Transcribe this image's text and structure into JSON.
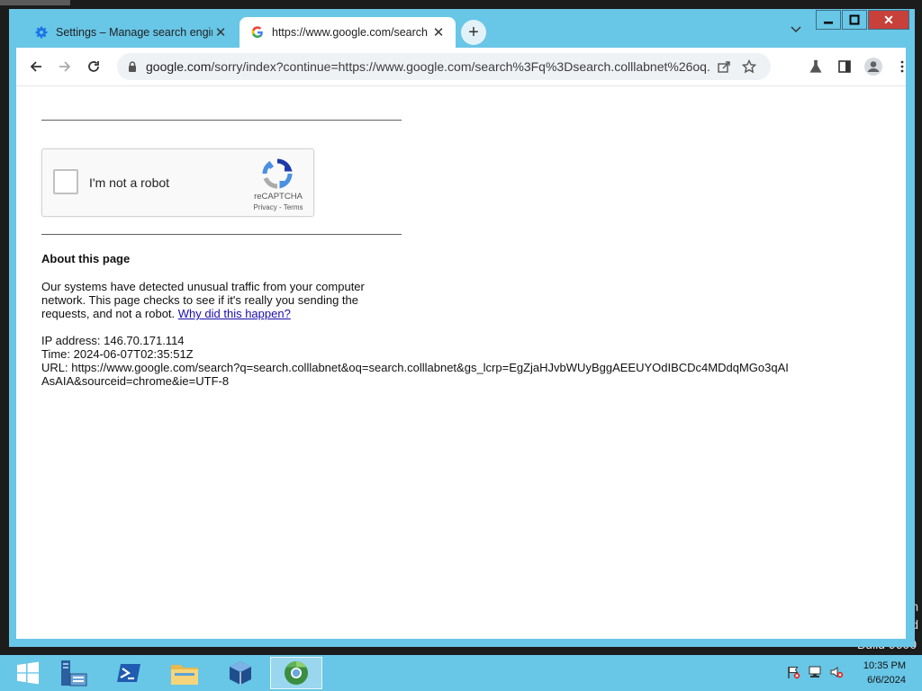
{
  "browser": {
    "tabs": [
      {
        "title": "Settings – Manage search engin",
        "icon": "settings-gear-icon",
        "active": false
      },
      {
        "title": "https://www.google.com/search",
        "icon": "google-g-icon",
        "active": true
      }
    ],
    "omnibox": {
      "host": "google.com",
      "path": "/sorry/index?continue=https://www.google.com/search%3Fq%3Dsearch.colllabnet%26oq..."
    }
  },
  "page": {
    "captcha": {
      "label": "I'm not a robot",
      "brand": "reCAPTCHA",
      "links": "Privacy - Terms"
    },
    "about_heading": "About this page",
    "paragraph": {
      "text": "Our systems have detected unusual traffic from your computer network. This page checks to see if it's really you sending the requests, and not a robot. ",
      "link": "Why did this happen?"
    },
    "info": {
      "ip": "IP address: 146.70.171.114",
      "time": "Time: 2024-06-07T02:35:51Z",
      "url": "URL: https://www.google.com/search?q=search.colllabnet&oq=search.colllabnet&gs_lcrp=EgZjaHJvbWUyBggAEEUYOdIBCDc4MDdqMGo3qAIAsAIA&sourceid=chrome&ie=UTF-8"
    }
  },
  "desktop": {
    "build_text": "Build 9600",
    "edge_chars": [
      "n",
      "d"
    ]
  },
  "taskbar": {
    "items": [
      "start-windows-icon",
      "server-manager-icon",
      "powershell-icon",
      "file-explorer-icon",
      "virtualbox-icon",
      "chrome-icon"
    ],
    "clock_time": "10:35 PM",
    "clock_date": "6/6/2024"
  }
}
